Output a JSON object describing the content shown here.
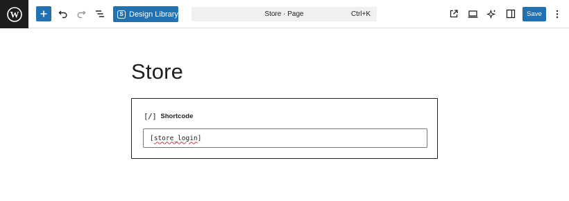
{
  "toolbar": {
    "logo_icon": "wordpress-icon",
    "add_icon": "plus-icon",
    "undo_icon": "undo-icon",
    "redo_icon": "redo-icon",
    "list_view_icon": "list-view-icon",
    "design_library": {
      "badge": "S",
      "label": "Design Library"
    },
    "document": {
      "title": "Store · Page",
      "shortcut": "Ctrl+K"
    },
    "view_page_icon": "external-link-icon",
    "preview_icon": "desktop-preview-icon",
    "ai_icon": "sparkle-icon",
    "settings_icon": "sidebar-toggle-icon",
    "save_label": "Save",
    "options_icon": "more-vertical-icon",
    "accent_color": "#2271b1"
  },
  "page": {
    "title": "Store"
  },
  "shortcode_block": {
    "icon": "[/]",
    "label": "Shortcode",
    "value_open": "[",
    "value_word": "store_login",
    "value_close": "]"
  }
}
